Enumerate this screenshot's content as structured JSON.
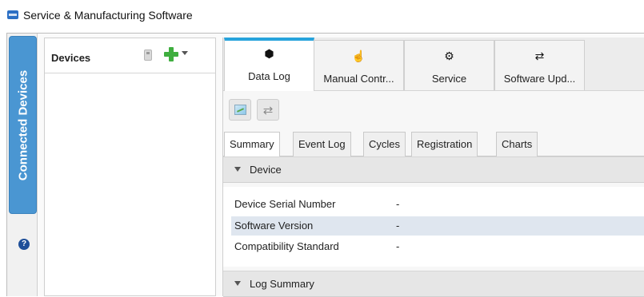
{
  "window": {
    "title": "Service & Manufacturing Software"
  },
  "rail": {
    "tab_label": "Connected Devices",
    "help_glyph": "?"
  },
  "devices": {
    "title": "Devices"
  },
  "ribbon": {
    "tabs": [
      {
        "label": "Data Log",
        "icon": "cube-icon",
        "glyph": "⬢"
      },
      {
        "label": "Manual Contr...",
        "icon": "hand-icon",
        "glyph": "☝"
      },
      {
        "label": "Service",
        "icon": "gear-wrench-icon",
        "glyph": "⚙"
      },
      {
        "label": "Software Upd...",
        "icon": "sync-icon",
        "glyph": "⇄"
      }
    ]
  },
  "toolbar": {
    "refresh_glyph": "⇄"
  },
  "subtabs": [
    "Summary",
    "Event Log",
    "Cycles",
    "Registration",
    "Charts"
  ],
  "sections": {
    "device": "Device",
    "log_summary": "Log Summary"
  },
  "device_props": [
    {
      "key": "Device Serial Number",
      "value": "-"
    },
    {
      "key": "Software Version",
      "value": "-"
    },
    {
      "key": "Compatibility Standard",
      "value": "-"
    }
  ],
  "colors": {
    "accent": "#27a3dc",
    "rail_tab": "#4a96d2",
    "highlight_row": "#dfe6ef"
  }
}
